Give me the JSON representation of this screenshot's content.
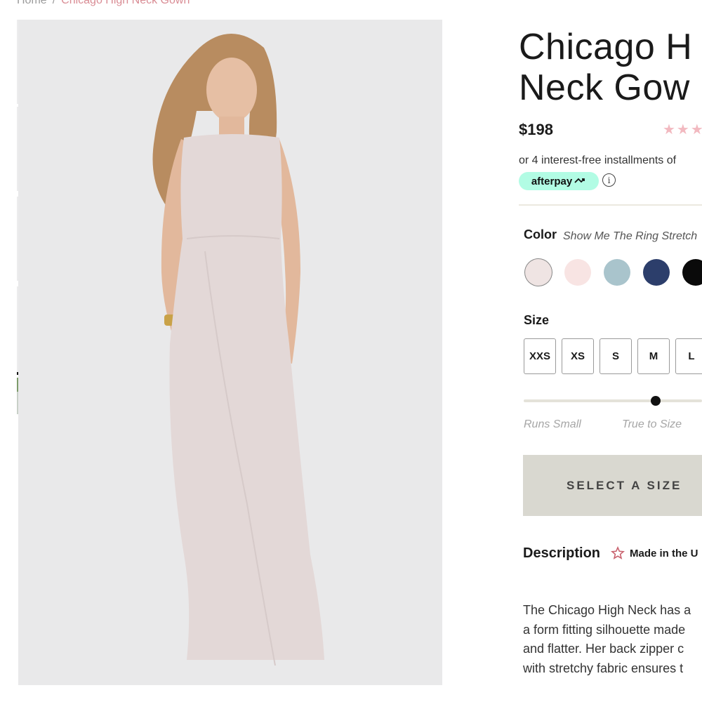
{
  "breadcrumb": {
    "home": "Home",
    "separator": "/",
    "current": "Chicago High Neck Gown"
  },
  "product": {
    "title_line1": "Chicago H",
    "title_line2": "Neck Gow",
    "price": "$198",
    "rating_stars": "★★★",
    "installments_text": "or 4 interest-free installments of",
    "afterpay_label": "afterpay",
    "afterpay_icon": "afterpay-loop-arrow",
    "info_icon": "i"
  },
  "color": {
    "label": "Color",
    "selected_name": "Show Me The Ring Stretch",
    "swatches": [
      {
        "name": "show-me-the-ring",
        "hex": "#efe4e3"
      },
      {
        "name": "blush",
        "hex": "#f8e4e3"
      },
      {
        "name": "dusty-blue",
        "hex": "#a9c4cc"
      },
      {
        "name": "navy",
        "hex": "#2c3e6b"
      },
      {
        "name": "black",
        "hex": "#0a0a0a"
      }
    ]
  },
  "size": {
    "label": "Size",
    "options": [
      "XXS",
      "XS",
      "S",
      "M",
      "L"
    ]
  },
  "fit": {
    "left_label": "Runs Small",
    "middle_label": "True to Size",
    "value_fraction": 0.74
  },
  "cta": {
    "select_size": "SELECT A SIZE"
  },
  "description": {
    "label": "Description",
    "made_in": "Made in the U",
    "lines": [
      "The Chicago High Neck has a",
      "a form fitting silhouette made",
      "and flatter. Her back zipper c",
      "with stretchy fabric ensures t"
    ]
  },
  "colors": {
    "accent_pink": "#d98c94",
    "afterpay_mint": "#b2fce4",
    "cta_bg": "#d9d8d0",
    "image_bg": "#e9e9ea"
  }
}
